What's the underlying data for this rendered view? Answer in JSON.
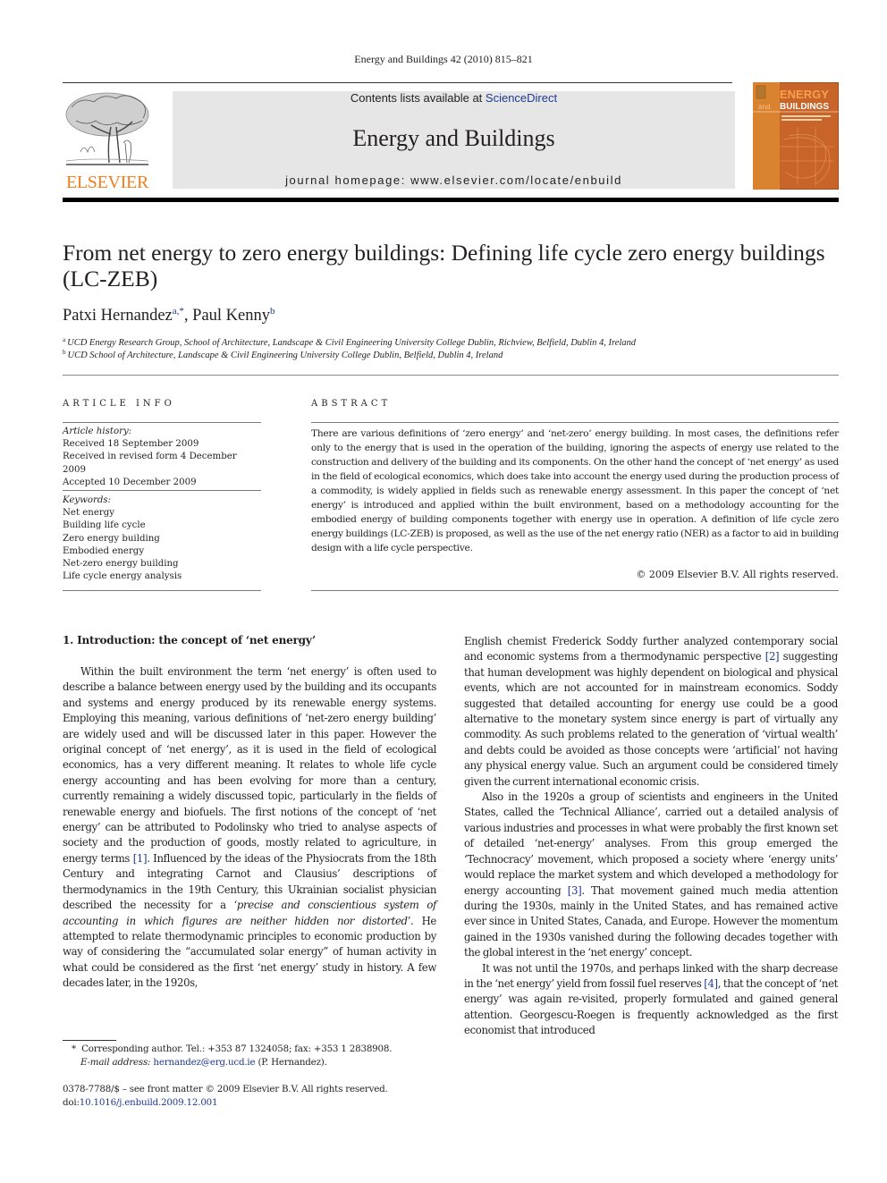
{
  "running_head": "Energy and Buildings 42 (2010) 815–821",
  "masthead": {
    "contents_prefix": "Contents lists available at ",
    "contents_link": "ScienceDirect",
    "journal_name": "Energy and Buildings",
    "homepage": "journal homepage: www.elsevier.com/locate/enbuild",
    "publisher_wordmark": "ELSEVIER",
    "cover": {
      "title_line1": "ENERGY",
      "title_prefix": "and",
      "title_line2": "BUILDINGS"
    },
    "colors": {
      "elsevier_orange": "#f07f1e",
      "band_grey": "#e6e6e6",
      "link_blue": "#1f3a93",
      "cover_orange": "#c8642a"
    }
  },
  "article": {
    "title": "From net energy to zero energy buildings: Defining life cycle zero energy buildings (LC-ZEB)",
    "authors": [
      {
        "name": "Patxi Hernandez",
        "sup": "a,*"
      },
      {
        "name": "Paul Kenny",
        "sup": "b"
      }
    ],
    "affiliations": [
      {
        "key": "a",
        "text": "UCD Energy Research Group, School of Architecture, Landscape & Civil Engineering University College Dublin, Richview, Belfield, Dublin 4, Ireland"
      },
      {
        "key": "b",
        "text": "UCD School of Architecture, Landscape & Civil Engineering University College Dublin, Belfield, Dublin 4, Ireland"
      }
    ]
  },
  "article_info": {
    "heading": "ARTICLE INFO",
    "history_label": "Article history:",
    "history": [
      "Received 18 September 2009",
      "Received in revised form 4 December 2009",
      "Accepted 10 December 2009"
    ],
    "keywords_label": "Keywords:",
    "keywords": [
      "Net energy",
      "Building life cycle",
      "Zero energy building",
      "Embodied energy",
      "Net-zero energy building",
      "Life cycle energy analysis"
    ]
  },
  "abstract": {
    "heading": "ABSTRACT",
    "text": "There are various definitions of ‘zero energy’ and ‘net-zero’ energy building. In most cases, the definitions refer only to the energy that is used in the operation of the building, ignoring the aspects of energy use related to the construction and delivery of the building and its components. On the other hand the concept of ‘net energy’ as used in the field of ecological economics, which does take into account the energy used during the production process of a commodity, is widely applied in fields such as renewable energy assessment. In this paper the concept of ‘net energy’ is introduced and applied within the built environment, based on a methodology accounting for the embodied energy of building components together with energy use in operation. A definition of life cycle zero energy buildings (LC-ZEB) is proposed, as well as the use of the net energy ratio (NER) as a factor to aid in building design with a life cycle perspective.",
    "copyright": "© 2009 Elsevier B.V. All rights reserved."
  },
  "body": {
    "section_heading": "1.  Introduction: the concept of ‘net energy’",
    "left_p1_a": "Within the built environment the term ‘net energy’ is often used to describe a balance between energy used by the building and its occupants and systems and energy produced by its renewable energy systems. Employing this meaning, various definitions of ‘net-zero energy building’ are widely used and will be discussed later in this paper. However the original concept of ‘net energy’, as it is used in the field of ecological economics, has a very different meaning. It relates to whole life cycle energy accounting and has been evolving for more than a century, currently remaining a widely discussed topic, particularly in the fields of renewable energy and biofuels. The first notions of the concept of ‘net energy’ can be attributed to Podolinsky who tried to analyse aspects of society and the production of goods, mostly related to agriculture, in energy terms ",
    "ref1": "[1]",
    "left_p1_b": ". Influenced by the ideas of the Physiocrats from the 18th Century and integrating Carnot and Clausius’ descriptions of thermodynamics in the 19th Century, this Ukrainian socialist physician described the necessity for a ‘",
    "left_p1_italic": "precise and conscientious system of accounting in which figures are neither hidden nor distorted",
    "left_p1_c": "’. He attempted to relate thermodynamic principles to economic production by way of considering the “accumulated solar energy” of human activity in what could be considered as the first ‘net energy’ study in history. A few decades later, in the 1920s,",
    "right_p1_a": "English chemist Frederick Soddy further analyzed contemporary social and economic systems from a thermodynamic perspective ",
    "ref2": "[2]",
    "right_p1_b": " suggesting that human development was highly dependent on biological and physical events, which are not accounted for in mainstream economics. Soddy suggested that detailed accounting for energy use could be a good alternative to the monetary system since energy is part of virtually any commodity. As such problems related to the generation of ‘virtual wealth’ and debts could be avoided as those concepts were ‘artificial’ not having any physical energy value. Such an argument could be considered timely given the current international economic crisis.",
    "right_p2_a": "Also in the 1920s a group of scientists and engineers in the United States, called the ‘Technical Alliance’, carried out a detailed analysis of various industries and processes in what were probably the first known set of detailed ‘net-energy’ analyses. From this group emerged the ‘Technocracy’ movement, which proposed a society where ‘energy units’ would replace the market system and which developed a methodology for energy accounting ",
    "ref3": "[3]",
    "right_p2_b": ". That movement gained much media attention during the 1930s, mainly in the United States, and has remained active ever since in United States, Canada, and Europe. However the momentum gained in the 1930s vanished during the following decades together with the global interest in the ‘net energy’ concept.",
    "right_p3_a": "It was not until the 1970s, and perhaps linked with the sharp decrease in the ‘net energy’ yield from fossil fuel reserves ",
    "ref4": "[4]",
    "right_p3_b": ", that the concept of ‘net energy’ was again re-visited, properly formulated and gained general attention. Georgescu-Roegen is frequently acknowledged as the first economist that introduced"
  },
  "footnotes": {
    "corresponding_marker": "*",
    "corresponding": "Corresponding author. Tel.: +353 87 1324058; fax: +353 1 2838908.",
    "email_label": "E-mail address:",
    "email": "hernandez@erg.ucd.ie",
    "email_suffix": " (P. Hernandez).",
    "issn_line": "0378-7788/$ – see front matter © 2009 Elsevier B.V. All rights reserved.",
    "doi_prefix": "doi:",
    "doi": "10.1016/j.enbuild.2009.12.001"
  }
}
